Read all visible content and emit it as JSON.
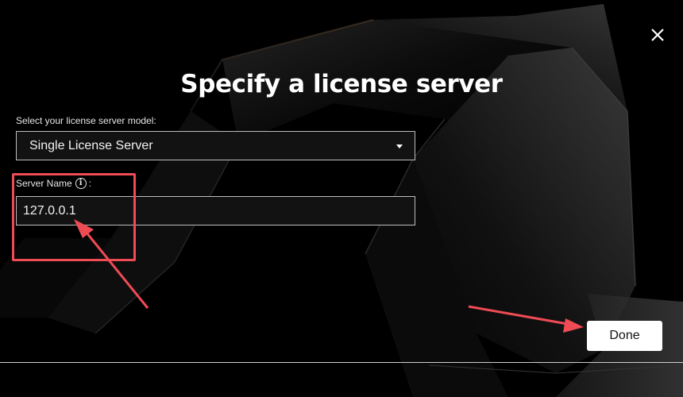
{
  "dialog": {
    "title": "Specify a license server",
    "close_icon": "close-icon"
  },
  "model": {
    "label": "Select your license server model:",
    "selected": "Single License Server"
  },
  "server": {
    "label": "Server Name",
    "label_suffix": ":",
    "info_glyph": "i",
    "value": "127.0.0.1"
  },
  "actions": {
    "done_label": "Done"
  },
  "annotations": {
    "color": "#ef4b55"
  }
}
